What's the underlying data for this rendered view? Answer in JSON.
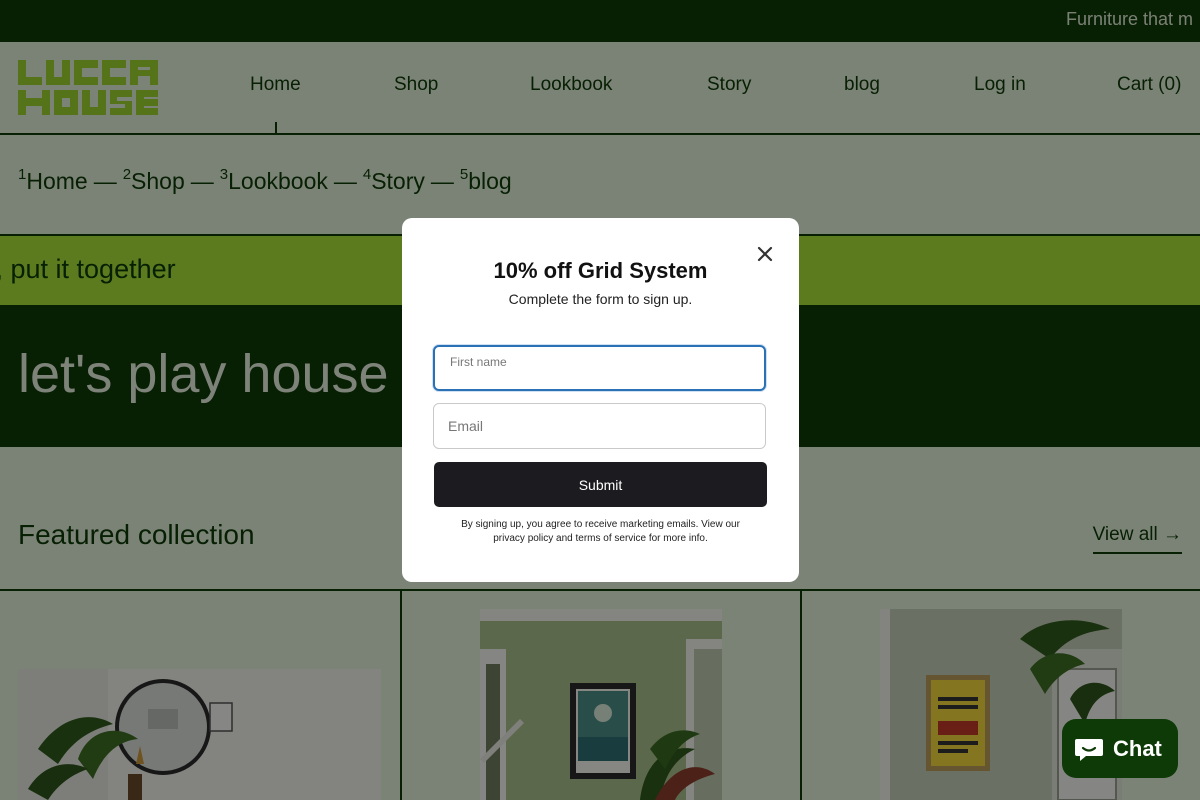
{
  "announcement": {
    "text": "Furniture that m"
  },
  "header": {
    "logo_text": "LUCCA HOUSE",
    "nav": [
      {
        "label": "Home"
      },
      {
        "label": "Shop"
      },
      {
        "label": "Lookbook"
      },
      {
        "label": "Story"
      },
      {
        "label": "blog"
      },
      {
        "label": "Log in"
      },
      {
        "label": "Cart (0)"
      }
    ]
  },
  "breadcrumbs": [
    {
      "num": "1",
      "label": "Home"
    },
    {
      "num": "2",
      "label": "Shop"
    },
    {
      "num": "3",
      "label": "Lookbook"
    },
    {
      "num": "4",
      "label": "Story"
    },
    {
      "num": "5",
      "label": "blog"
    }
  ],
  "breadcrumb_separator": "—",
  "band": {
    "text": "t, put it together"
  },
  "hero": {
    "title": "let's play house"
  },
  "featured": {
    "title": "Featured collection",
    "view_all": "View all →"
  },
  "modal": {
    "title": "10% off Grid System",
    "subtitle": "Complete the form to sign up.",
    "first_name_label": "First name",
    "first_name_value": "",
    "email_placeholder": "Email",
    "email_value": "",
    "submit_label": "Submit",
    "legal": "By signing up, you agree to receive marketing emails. View our privacy policy and terms of service for more info."
  },
  "chat": {
    "label": "Chat"
  },
  "colors": {
    "brand_dark": "#0d3a06",
    "brand_lime": "#a8e03a",
    "background": "#e1eed9",
    "poster_yellow": "#f1d73b"
  },
  "icons": {
    "close": "close-icon",
    "chat": "chat-bubble-icon"
  }
}
